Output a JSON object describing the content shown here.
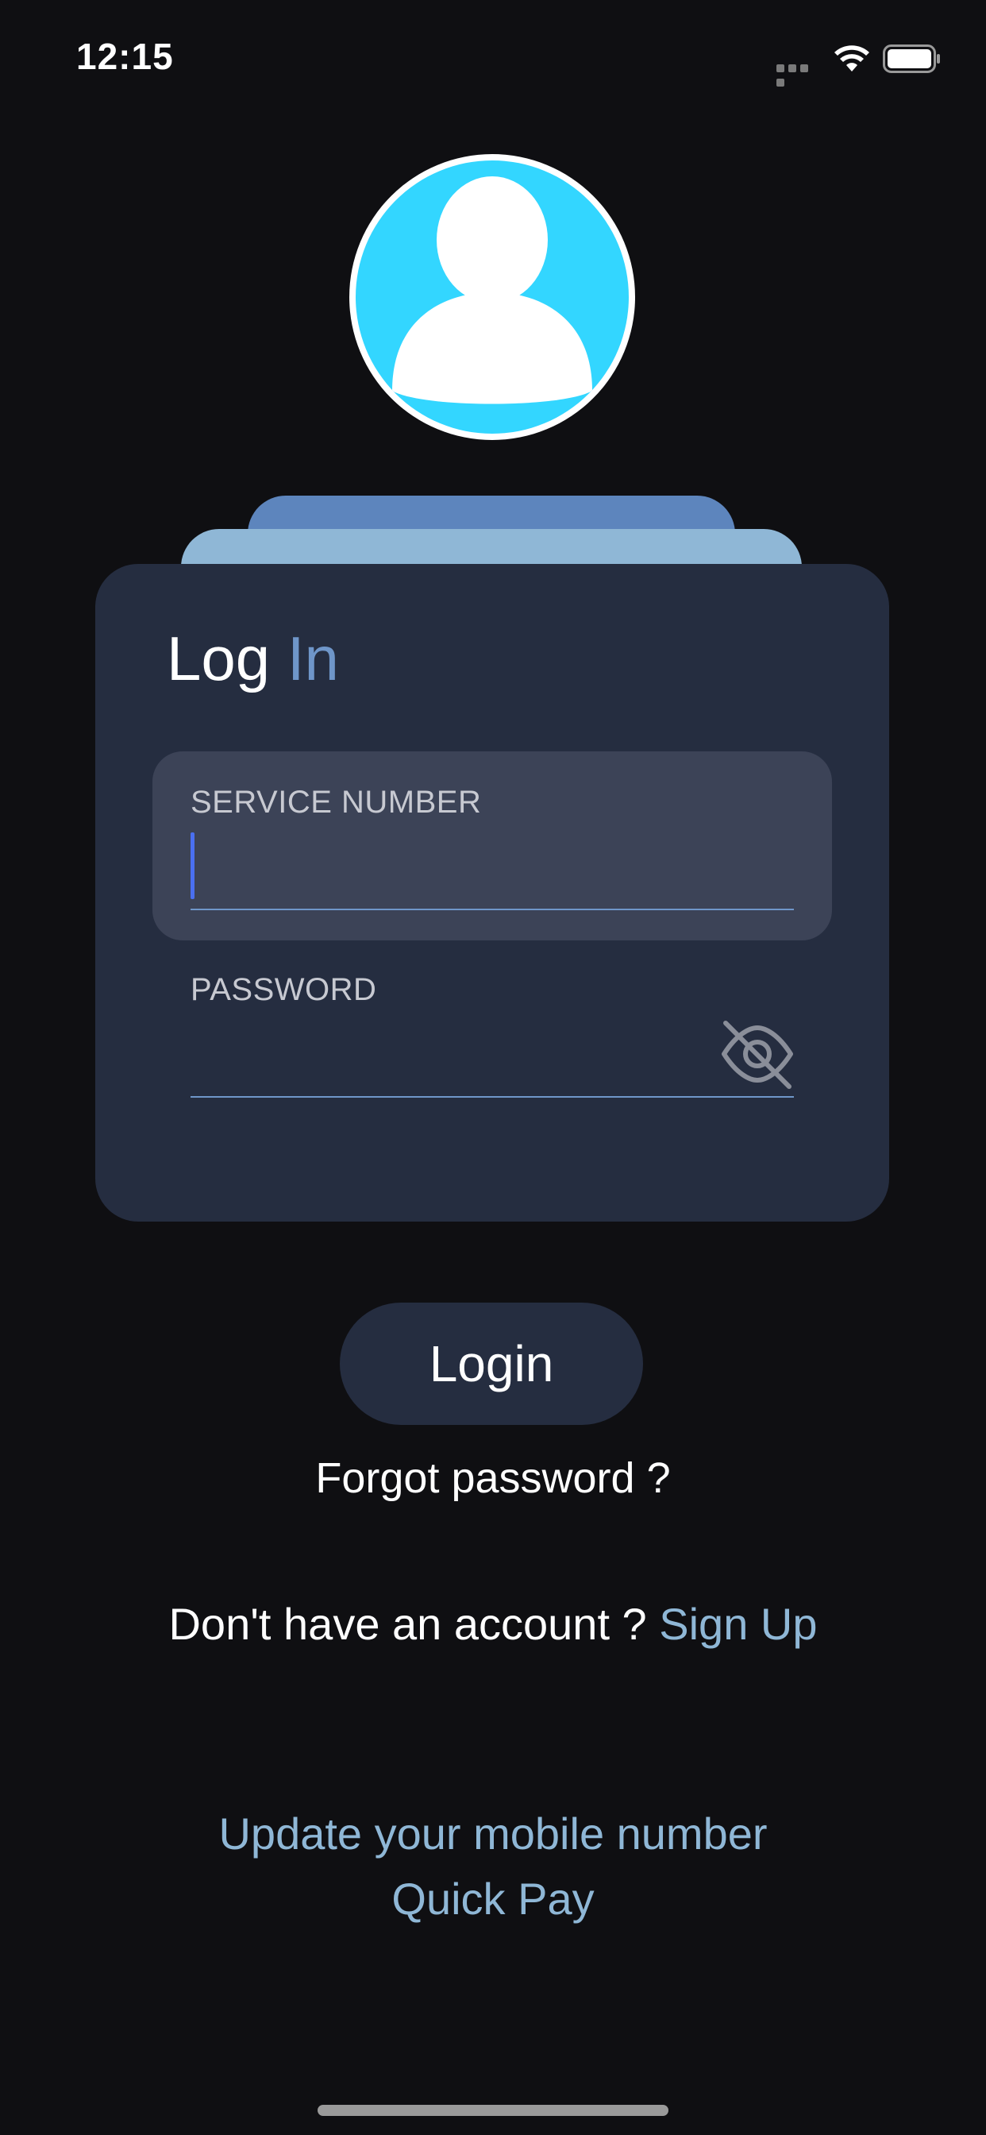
{
  "status_bar": {
    "time": "12:15"
  },
  "card": {
    "title_part1": "Log",
    "title_part2": "In",
    "service_number_label": "SERVICE NUMBER",
    "service_number_value": "",
    "password_label": "PASSWORD",
    "password_value": ""
  },
  "actions": {
    "login_label": "Login",
    "forgot_label": "Forgot password ?",
    "no_account_text": "Don't have an account ?",
    "signup_label": "Sign Up",
    "update_mobile_label": "Update your mobile number",
    "quick_pay_label": "Quick Pay"
  },
  "icons": {
    "avatar": "user-avatar-icon",
    "password_toggle": "eye-off-icon",
    "wifi": "wifi-icon",
    "battery": "battery-icon",
    "signal": "cellular-signal-icon"
  },
  "colors": {
    "background": "#0f0f12",
    "card": "#252d40",
    "field_active": "#3c4357",
    "accent": "#6f96c9",
    "link": "#8fb7d6",
    "avatar_bg": "#33d6ff",
    "caret": "#4a6ff0"
  }
}
